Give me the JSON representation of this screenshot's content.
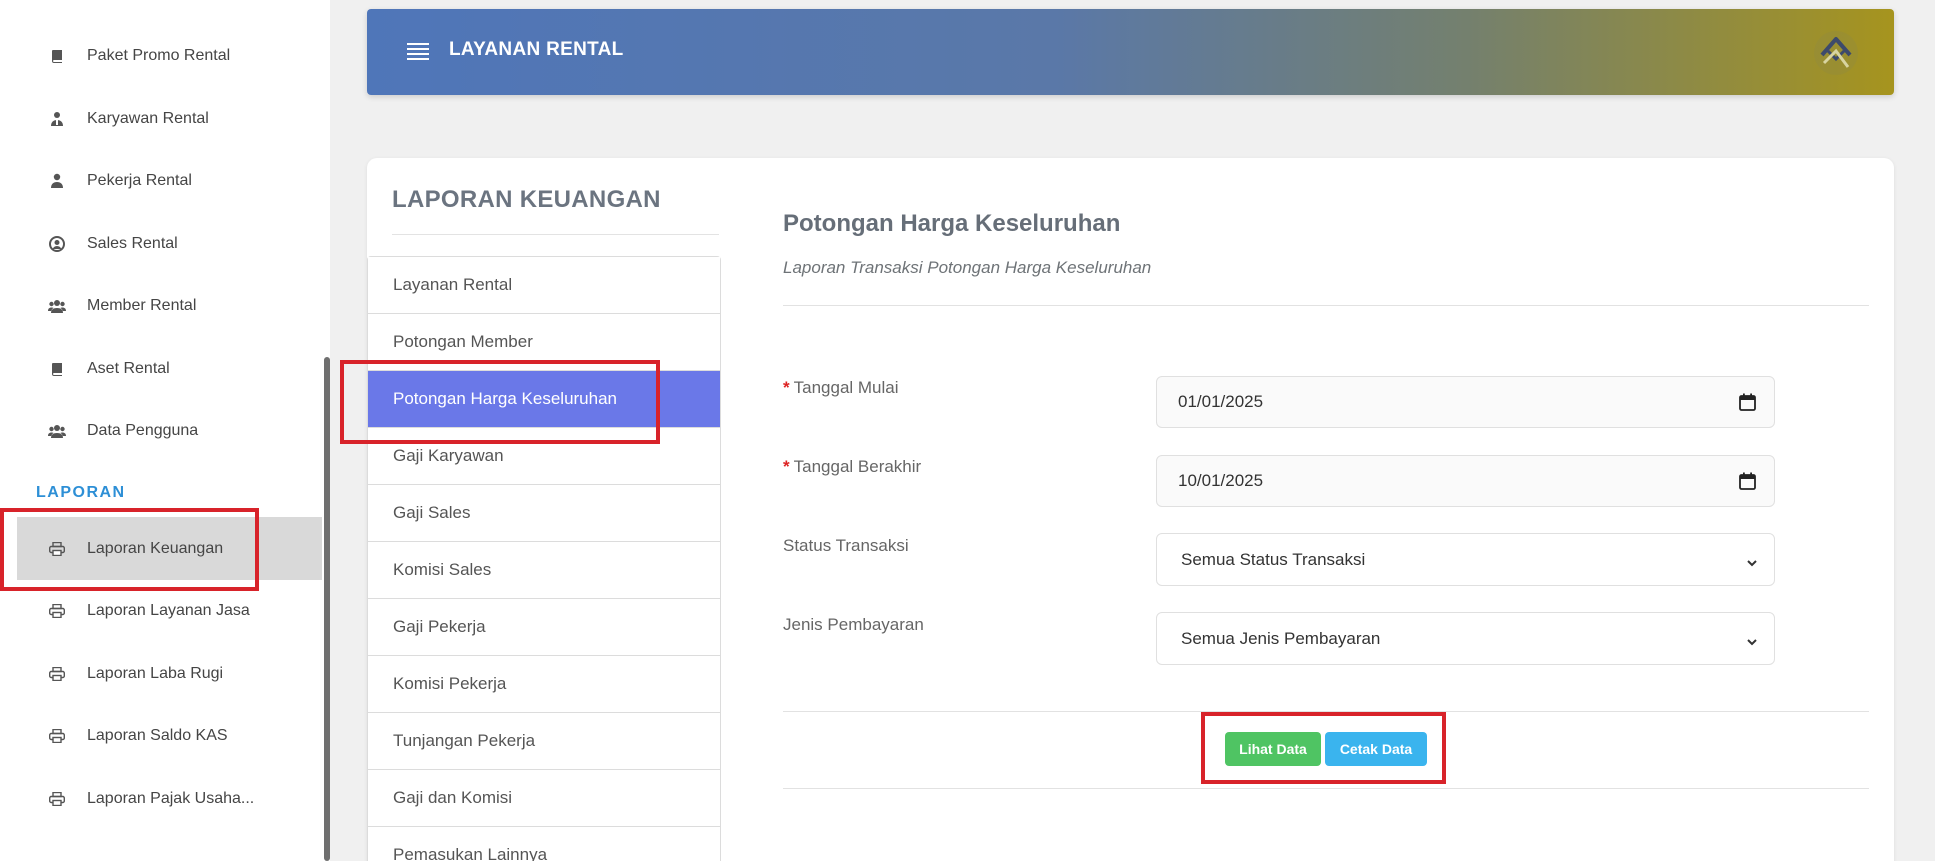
{
  "sidebar": {
    "items": [
      {
        "label": "Paket Promo Rental",
        "icon": "book-icon"
      },
      {
        "label": "Karyawan Rental",
        "icon": "user-tie-icon"
      },
      {
        "label": "Pekerja Rental",
        "icon": "user-icon"
      },
      {
        "label": "Sales Rental",
        "icon": "user-circle-icon"
      },
      {
        "label": "Member Rental",
        "icon": "users-icon"
      },
      {
        "label": "Aset Rental",
        "icon": "book-icon"
      },
      {
        "label": "Data Pengguna",
        "icon": "users-icon"
      }
    ],
    "section_heading": "LAPORAN",
    "report_items": [
      {
        "label": "Laporan Keuangan",
        "icon": "printer-icon",
        "active": true
      },
      {
        "label": "Laporan Layanan Jasa",
        "icon": "printer-icon"
      },
      {
        "label": "Laporan Laba Rugi",
        "icon": "printer-icon"
      },
      {
        "label": "Laporan Saldo KAS",
        "icon": "printer-icon"
      },
      {
        "label": "Laporan Pajak Usaha...",
        "icon": "printer-icon"
      }
    ]
  },
  "header": {
    "title": "LAYANAN RENTAL",
    "gradient": [
      "#4f76b9",
      "#a6941e"
    ]
  },
  "report_menu": {
    "title": "LAPORAN KEUANGAN",
    "items": [
      "Layanan Rental",
      "Potongan Member",
      "Potongan Harga Keseluruhan",
      "Gaji Karyawan",
      "Gaji Sales",
      "Komisi Sales",
      "Gaji Pekerja",
      "Komisi Pekerja",
      "Tunjangan Pekerja",
      "Gaji dan Komisi",
      "Pemasukan Lainnya"
    ],
    "active_index": 2,
    "active_color": "#6a78e8"
  },
  "form": {
    "title": "Potongan Harga Keseluruhan",
    "subtitle": "Laporan Transaksi Potongan Harga Keseluruhan",
    "start_date_label": "Tanggal Mulai",
    "start_date_value": "01/01/2025",
    "end_date_label": "Tanggal Berakhir",
    "end_date_value": "10/01/2025",
    "status_label": "Status Transaksi",
    "status_value": "Semua Status Transaksi",
    "payment_label": "Jenis Pembayaran",
    "payment_value": "Semua Jenis Pembayaran",
    "required_mark": "*",
    "view_button": "Lihat Data",
    "print_button": "Cetak Data"
  },
  "colors": {
    "highlight": "#d8232a",
    "view_button": "#4fc463",
    "print_button": "#3ab4ee",
    "section_heading": "#2d8fd6"
  }
}
